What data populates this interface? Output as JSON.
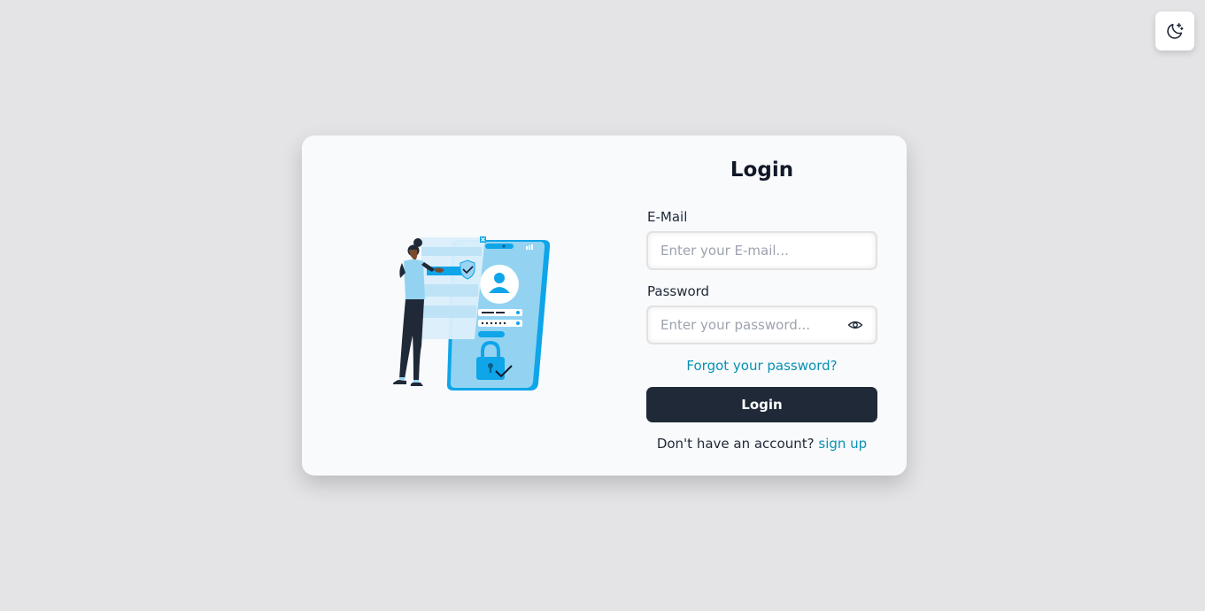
{
  "theme_toggle": {
    "icon": "moon-sparkle-icon"
  },
  "illustration": {
    "icon": "phone-login-security-illustration"
  },
  "form": {
    "title": "Login",
    "email_label": "E-Mail",
    "email_placeholder": "Enter your E-mail...",
    "password_label": "Password",
    "password_placeholder": "Enter your password...",
    "password_toggle_icon": "eye-icon",
    "forgot_link": "Forgot your password?",
    "login_button": "Login",
    "signup_prompt": "Don't have an account?",
    "signup_link": "sign up"
  },
  "colors": {
    "background": "#e4e4e7",
    "card": "#f8fafc",
    "primary_button": "#1f2937",
    "link": "#0891b2",
    "illustration_blue": "#0ea5e9"
  }
}
